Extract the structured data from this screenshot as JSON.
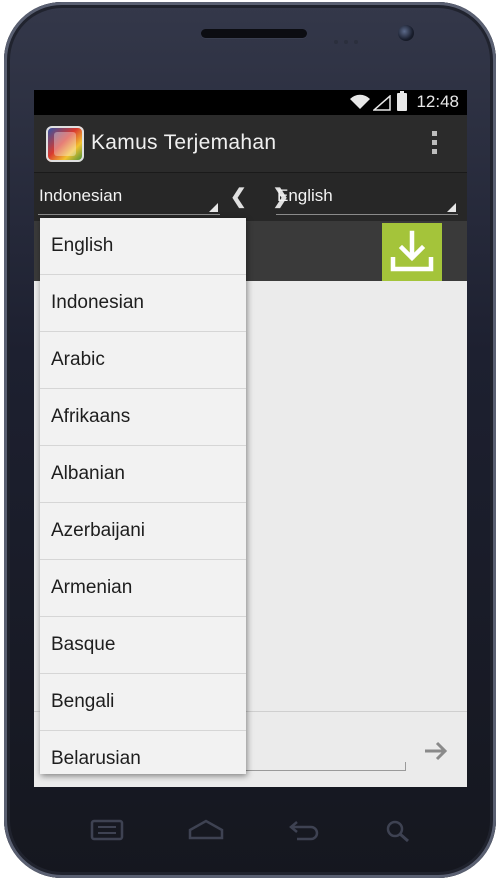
{
  "statusbar": {
    "time": "12:48"
  },
  "actionbar": {
    "title": "Kamus Terjemahan"
  },
  "languages": {
    "source": "Indonesian",
    "target": "English",
    "swap_label": "❮ ❯"
  },
  "dropdown": {
    "items": [
      "English",
      "Indonesian",
      "Arabic",
      "Afrikaans",
      "Albanian",
      "Azerbaijani",
      "Armenian",
      "Basque",
      "Bengali",
      "Belarusian"
    ]
  },
  "colors": {
    "accent": "#a4c43a",
    "actionbar": "#2b2b2b"
  },
  "icons": {
    "download": "download-icon",
    "send": "arrow-right-icon",
    "overflow": "overflow-menu-icon"
  }
}
